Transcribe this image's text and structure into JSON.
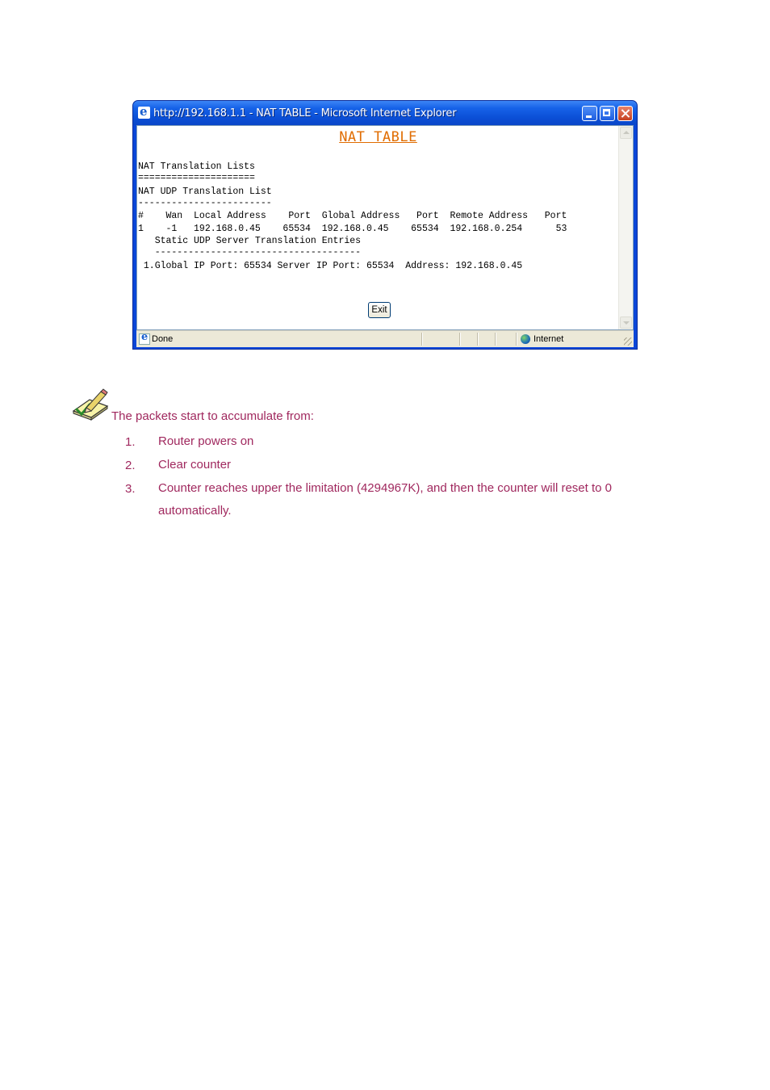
{
  "window": {
    "title": "http://192.168.1.1 - NAT TABLE - Microsoft Internet Explorer",
    "status": "Done",
    "zone": "Internet"
  },
  "page": {
    "heading": "NAT TABLE",
    "lines": [
      "NAT Translation Lists",
      "=====================",
      "NAT UDP Translation List",
      "------------------------",
      "#    Wan  Local Address    Port  Global Address   Port  Remote Address   Port",
      "1    -1   192.168.0.45    65534  192.168.0.45    65534  192.168.0.254      53",
      "   Static UDP Server Translation Entries",
      "   -------------------------------------",
      " 1.Global IP Port: 65534 Server IP Port: 65534  Address: 192.168.0.45"
    ],
    "exit_label": "Exit"
  },
  "note": {
    "intro": "The packets start to accumulate from:",
    "items": [
      {
        "num": "1.",
        "text": "Router powers on"
      },
      {
        "num": "2.",
        "text": "Clear counter"
      },
      {
        "num": "3.",
        "text": "Counter reaches upper the limitation (4294967K), and then the counter will reset to 0",
        "text2": "automatically."
      }
    ]
  }
}
